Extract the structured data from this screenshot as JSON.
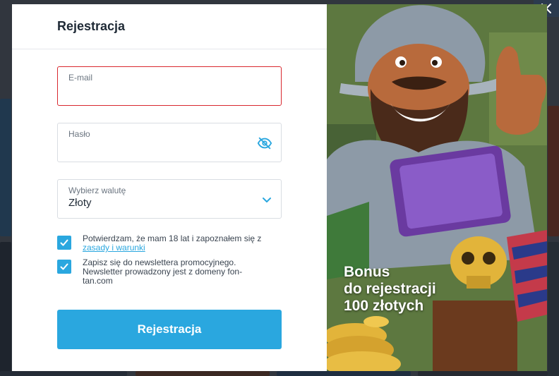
{
  "modal": {
    "title": "Rejestracja",
    "close_icon": "close-icon"
  },
  "form": {
    "email": {
      "label": "E-mail",
      "value": ""
    },
    "password": {
      "label": "Hasło",
      "value": "",
      "icon": "eye-off-icon"
    },
    "currency": {
      "label": "Wybierz walutę",
      "value": "Złoty",
      "icon": "chevron-down-icon"
    },
    "consent_age": {
      "checked": true,
      "text": "Potwierdzam, że mam 18 lat i zapoznałem się z",
      "link": "zasady i warunki"
    },
    "consent_newsletter": {
      "checked": true,
      "text": "Zapisz się do newslettera promocyjnego. Newsletter prowadzony jest z domeny fon-tan.com"
    },
    "submit_label": "Rejestracja"
  },
  "promo": {
    "line1": "Bonus",
    "line2": "do rejestracji",
    "line3": "100 złotych"
  },
  "colors": {
    "accent": "#2aa7df",
    "error": "#d9282f",
    "title": "#1f2a36",
    "close_bg": "#2b3a4e"
  }
}
